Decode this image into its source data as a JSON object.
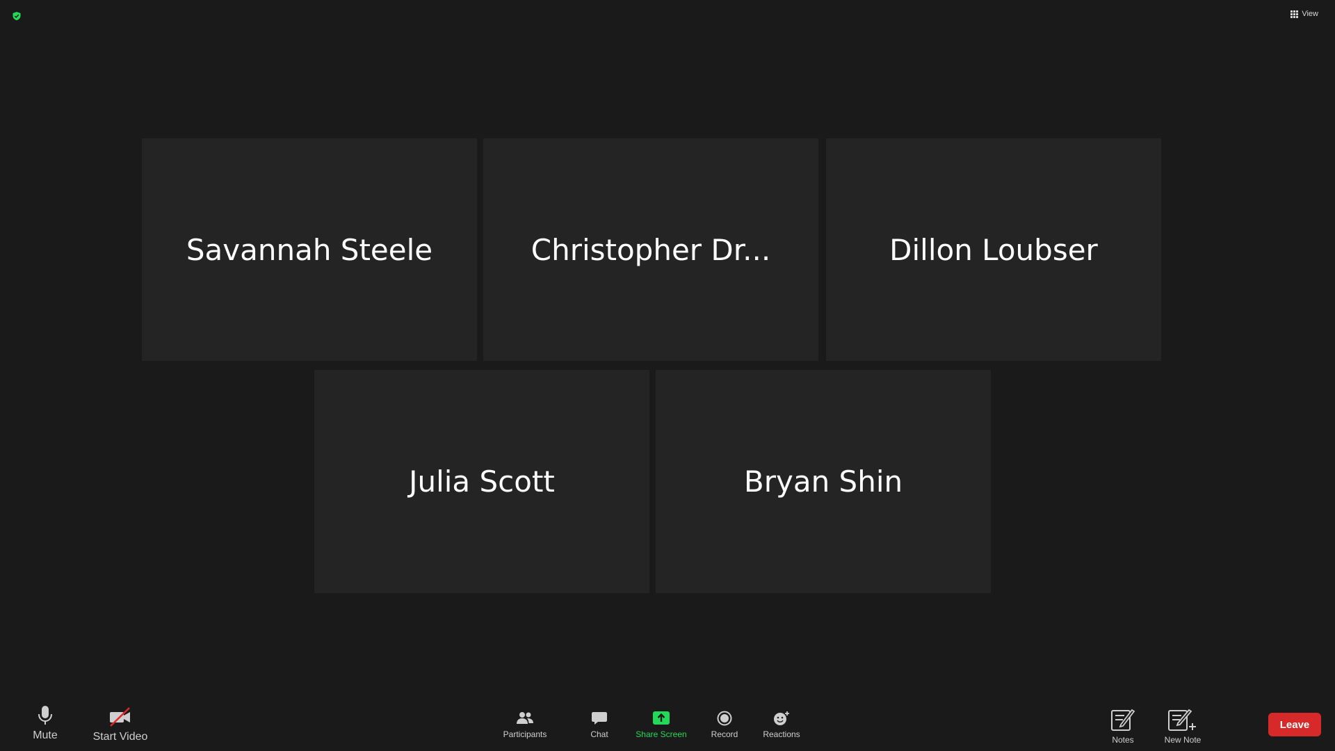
{
  "top_bar": {
    "view_label": "View"
  },
  "participants": [
    {
      "name": "Savannah Steele"
    },
    {
      "name": "Christopher Dr..."
    },
    {
      "name": "Dillon Loubser"
    },
    {
      "name": "Julia Scott"
    },
    {
      "name": "Bryan Shin"
    }
  ],
  "toolbar": {
    "mute_label": "Mute",
    "start_video_label": "Start Video",
    "participants_label": "Participants",
    "chat_label": "Chat",
    "share_screen_label": "Share Screen",
    "record_label": "Record",
    "reactions_label": "Reactions",
    "notes_label": "Notes",
    "new_note_label": "New Note",
    "leave_label": "Leave"
  },
  "colors": {
    "background": "#1a1a1a",
    "tile": "#242424",
    "share_green": "#23d959",
    "leave_red": "#d62929",
    "video_off_red": "#e02828",
    "secure_green": "#23d959"
  },
  "icons": {
    "secure": "shield-check-icon",
    "view": "grid-icon",
    "mute": "microphone-icon",
    "start_video": "video-camera-off-icon",
    "participants": "people-icon",
    "chat": "chat-bubble-icon",
    "share_screen": "share-screen-arrow-icon",
    "record": "record-icon",
    "reactions": "smiley-plus-icon",
    "notes": "note-pencil-icon",
    "new_note": "note-plus-icon"
  }
}
